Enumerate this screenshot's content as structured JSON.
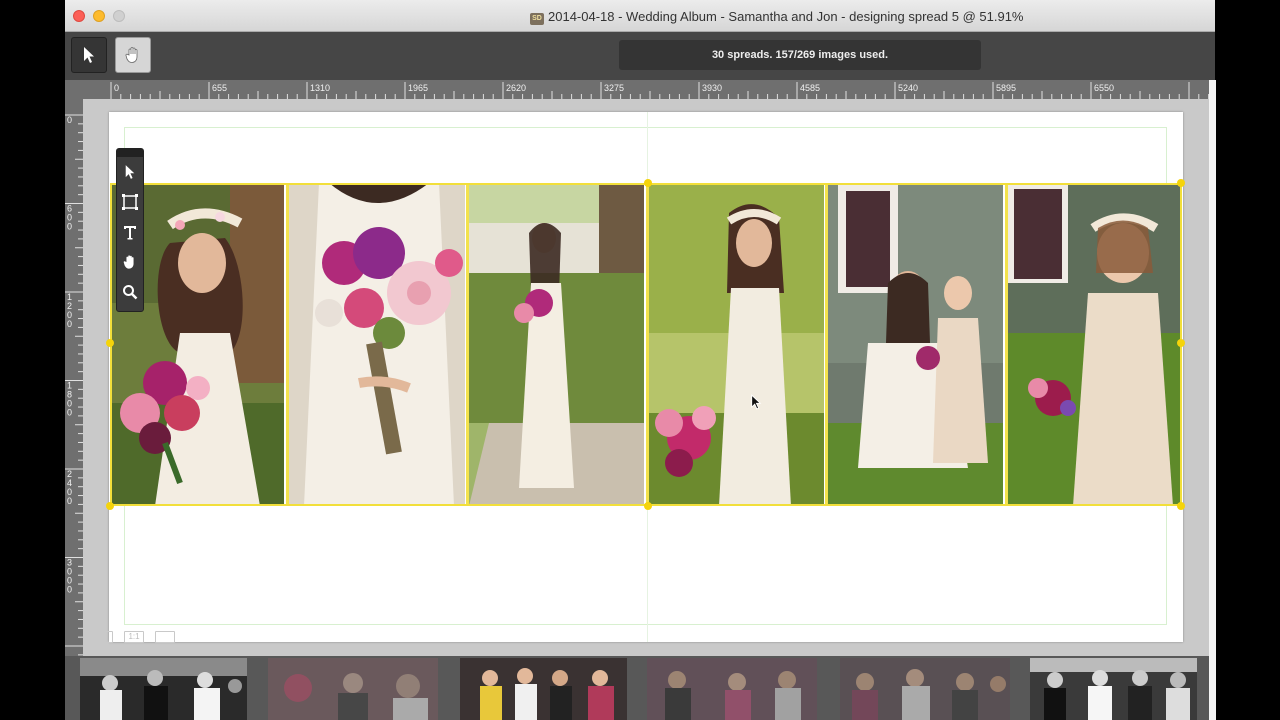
{
  "window": {
    "title": "2014-04-18 - Wedding Album - Samantha and Jon - designing spread 5 @ 51.91%",
    "app_badge": "SD"
  },
  "toolbar": {
    "status": "30 spreads. 157/269 images used."
  },
  "ruler_top": {
    "ticks": [
      "0",
      "655",
      "1310",
      "1965",
      "2620",
      "3275",
      "3930",
      "4585",
      "5240",
      "5895",
      "6550"
    ]
  },
  "ruler_left": {
    "ticks": [
      "0",
      "600",
      "1200",
      "1800",
      "2400",
      "3000"
    ]
  },
  "view_controls": {
    "actual_size_label": "1:1"
  },
  "spread": {
    "photos": [
      {
        "name": "bride-with-bouquet-closeup",
        "background": "#6a7a3a"
      },
      {
        "name": "bouquet-detail",
        "background": "#d9cfc0"
      },
      {
        "name": "bride-walking-path",
        "background": "#8da256"
      },
      {
        "name": "bride-standing-garden",
        "background": "#b7c06a"
      },
      {
        "name": "bride-with-flower-girl",
        "background": "#6b7565"
      },
      {
        "name": "flower-girl-portrait",
        "background": "#5e7048"
      }
    ],
    "selection_color": "#f2df3a"
  },
  "filmstrip": {
    "thumbnails": [
      {
        "name": "reception-dance-1",
        "tone": "bw",
        "dim": false
      },
      {
        "name": "reception-dance-2",
        "tone": "color",
        "dim": true
      },
      {
        "name": "reception-dance-3",
        "tone": "color",
        "dim": false
      },
      {
        "name": "reception-dance-4",
        "tone": "color",
        "dim": true
      },
      {
        "name": "reception-dance-5",
        "tone": "color",
        "dim": true
      },
      {
        "name": "reception-dance-6",
        "tone": "bw",
        "dim": false
      }
    ]
  }
}
